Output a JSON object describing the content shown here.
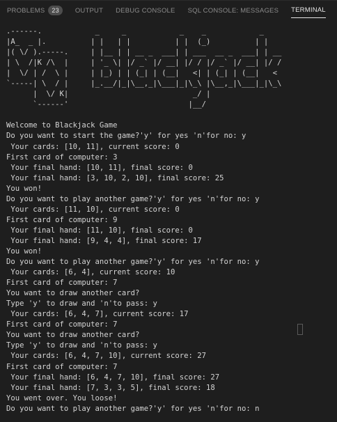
{
  "tabs": [
    {
      "label": "PROBLEMS",
      "badge": "23",
      "active": false
    },
    {
      "label": "OUTPUT",
      "active": false
    },
    {
      "label": "DEBUG CONSOLE",
      "active": false
    },
    {
      "label": "SQL CONSOLE: MESSAGES",
      "active": false
    },
    {
      "label": "TERMINAL",
      "active": true
    }
  ],
  "terminal": {
    "lines": [
      ".------.            _     _            _    _            _",
      "|A_  _ |.          | |   | |          | |  (_)          | |",
      "|( \\/ ).-----.     | |__ | | __ _  ___| | ___  __ _  ___| | __",
      "| \\  /|K /\\  |     | '_ \\| |/ _` |/ __| |/ / |/ _` |/ __| |/ /",
      "|  \\/ | /  \\ |     | |_) | | (_| | (__|   <| | (_| | (__|   <",
      "`-----| \\  / |     |_.__/|_|\\__,_|\\___|_|\\_\\ |\\__,_|\\___|_|\\_\\",
      "      |  \\/ K|                            _/ |",
      "      `------'                           |__/",
      "",
      "Welcome to Blackjack Game",
      "Do you want to start the game?'y' for yes 'n'for no: y",
      " Your cards: [10, 11], current score: 0",
      "First card of computer: 3",
      " Your final hand: [10, 11], final score: 0",
      " Your final hand: [3, 10, 2, 10], final score: 25",
      "You won!",
      "Do you want to play another game?'y' for yes 'n'for no: y",
      " Your cards: [11, 10], current score: 0",
      "First card of computer: 9",
      " Your final hand: [11, 10], final score: 0",
      " Your final hand: [9, 4, 4], final score: 17",
      "You won!",
      "Do you want to play another game?'y' for yes 'n'for no: y",
      " Your cards: [6, 4], current score: 10",
      "First card of computer: 7",
      "You want to draw another card?",
      "Type 'y' to draw and 'n'to pass: y",
      " Your cards: [6, 4, 7], current score: 17",
      "First card of computer: 7",
      "You want to draw another card?",
      "Type 'y' to draw and 'n'to pass: y",
      " Your cards: [6, 4, 7, 10], current score: 27",
      "First card of computer: 7",
      " Your final hand: [6, 4, 7, 10], final score: 27",
      " Your final hand: [7, 3, 3, 5], final score: 18",
      "You went over. You loose!",
      "Do you want to play another game?'y' for yes 'n'for no: n"
    ]
  }
}
